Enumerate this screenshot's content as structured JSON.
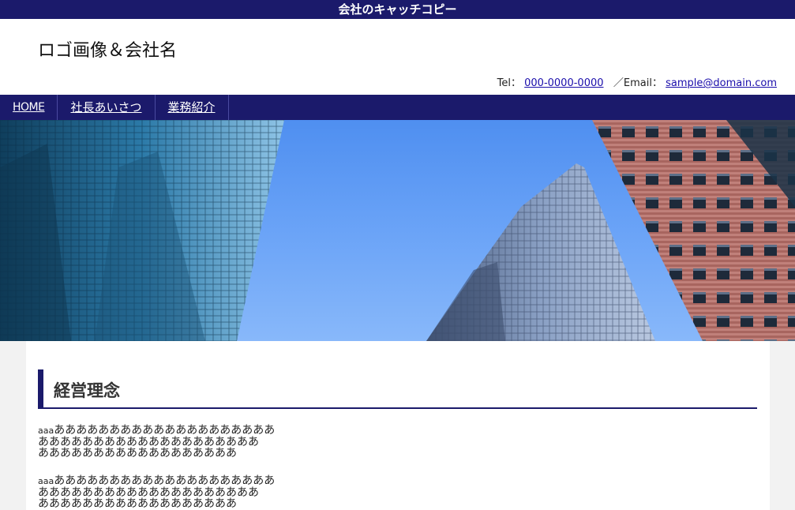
{
  "topbar": {
    "catchphrase": "会社のキャッチコピー"
  },
  "header": {
    "logo": "ロゴ画像＆会社名",
    "tel_label": "Tel：",
    "tel_value": "000-0000-0000",
    "email_label": "／Email：",
    "email_value": "sample@domain.com"
  },
  "nav": {
    "items": [
      {
        "label": "HOME"
      },
      {
        "label": "社長あいさつ"
      },
      {
        "label": "業務紹介"
      }
    ]
  },
  "main": {
    "heading": "経営理念",
    "paragraphs": [
      {
        "prefix": "aaa",
        "line1": "ああああああああああああああああああああ",
        "line2": "ああああああああああああああああああああ",
        "line3": "ああああああああああああああああああ"
      },
      {
        "prefix": "aaa",
        "line1": "ああああああああああああああああああああ",
        "line2": "ああああああああああああああああああああ",
        "line3": "ああああああああああああああああああ"
      }
    ]
  },
  "colors": {
    "brand_navy": "#1b1a6b",
    "link": "#1a0dab",
    "background": "#f2f2f2"
  },
  "hero": {
    "image_alt_icon": "office-buildings-photo"
  }
}
